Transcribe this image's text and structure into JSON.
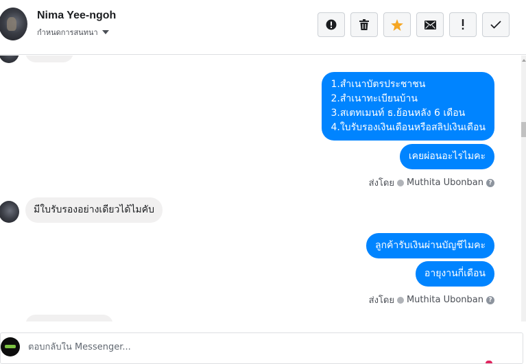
{
  "header": {
    "contact_name": "Nima Yee-ngoh",
    "assign_label": "กำหนดการสนทนา",
    "actions": [
      {
        "name": "report-button",
        "icon": "alert-circle-icon"
      },
      {
        "name": "delete-button",
        "icon": "trash-icon"
      },
      {
        "name": "star-button",
        "icon": "star-icon"
      },
      {
        "name": "mark-unread-button",
        "icon": "envelope-icon"
      },
      {
        "name": "mark-important-button",
        "icon": "exclamation-icon"
      },
      {
        "name": "mark-done-button",
        "icon": "checkmark-icon"
      }
    ]
  },
  "messages": {
    "out1": {
      "line1": "1.สำเนาบัตรประชาชน",
      "line2": "2.สำเนาทะเบียนบ้าน",
      "line3": "3.สเตทเมนท์ ธ.ย้อนหลัง 6 เดือน",
      "line4": "4.ใบรับรองเงินเดือนหรือสลิปเงินเดือน"
    },
    "out2": "เคยผ่อนอะไรไมคะ",
    "sent_by_1": {
      "prefix": "ส่งโดย",
      "agent": "Muthita Ubonban"
    },
    "in1": "มีใบรับรองอย่างเดียวได้ไมคับ",
    "out3": "ลูกค้ารับเงินผ่านบัญชีไมคะ",
    "out4": "อายุงานกี่เดือน",
    "sent_by_2": {
      "prefix": "ส่งโดย",
      "agent": "Muthita Ubonban"
    }
  },
  "composer": {
    "placeholder": "ตอบกลับใน Messenger..."
  },
  "colors": {
    "outgoing_bubble": "#0084ff",
    "incoming_bubble": "#f1f0f0",
    "star": "#f5a623"
  }
}
